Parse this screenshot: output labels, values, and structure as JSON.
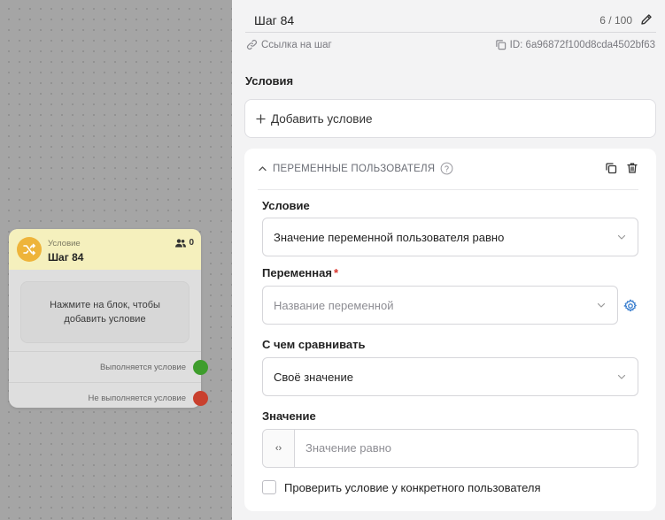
{
  "node": {
    "type_label": "Условие",
    "title": "Шаг 84",
    "users_count": "0",
    "body_text": "Нажмите на блок, чтобы добавить условие",
    "outputs": [
      {
        "label": "Выполняется условие",
        "color": "#3e9d2c"
      },
      {
        "label": "Не выполняется условие",
        "color": "#c9402e"
      }
    ],
    "icon_color": "#eeb43a"
  },
  "panel": {
    "step_title": "Шаг 84",
    "char_count": "6 / 100",
    "link_label": "Ссылка на шаг",
    "id_label": "ID: 6a96872f100d8cda4502bf63",
    "conditions_title": "Условия",
    "add_condition": "Добавить условие",
    "card": {
      "title": "ПЕРЕМЕННЫЕ ПОЛЬЗОВАТЕЛЯ",
      "condition_label": "Условие",
      "condition_value": "Значение переменной пользователя равно",
      "variable_label": "Переменная",
      "required_mark": "*",
      "variable_placeholder": "Название переменной",
      "compare_label": "С чем сравнивать",
      "compare_value": "Своё значение",
      "value_label": "Значение",
      "value_prefix": "‹›",
      "value_placeholder": "Значение равно",
      "check_label": "Проверить условие у конкретного пользователя"
    },
    "accent_color": "#3b7fcf"
  }
}
